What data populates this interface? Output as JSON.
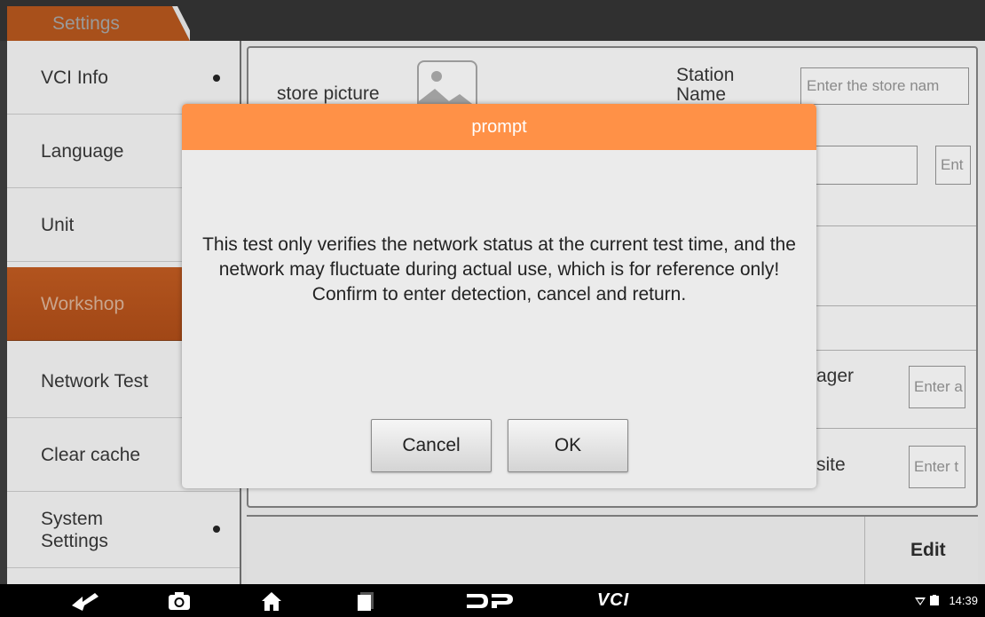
{
  "header": {
    "tab_label": "Settings"
  },
  "sidebar": {
    "items": [
      {
        "label": "VCI Info",
        "has_dot": true,
        "active": false
      },
      {
        "label": "Language",
        "has_dot": false,
        "active": false
      },
      {
        "label": "Unit",
        "has_dot": false,
        "active": false
      },
      {
        "label": "Workshop",
        "has_dot": false,
        "active": true
      },
      {
        "label": "Network Test",
        "has_dot": false,
        "active": false
      },
      {
        "label": "Clear cache",
        "has_dot": false,
        "active": false
      },
      {
        "label": "System Settings",
        "label_line1": "System",
        "label_line2": "Settings",
        "has_dot": true,
        "active": false
      }
    ]
  },
  "workshop": {
    "store_picture_label": "store picture",
    "station_name_label_line1": "Station",
    "station_name_label_line2": "Name",
    "store_name_placeholder": "Enter the store nam",
    "row2_input_placeholder": "Ent",
    "manager_label_fragment": "ager",
    "manager_input_placeholder": "Enter a",
    "website_label_fragment": "site",
    "website_input_placeholder": "Enter t",
    "edit_button_label": "Edit"
  },
  "dialog": {
    "title": "prompt",
    "message": "This test only verifies the network status at the current test time, and the network may fluctuate during actual use, which is for reference only! Confirm to enter detection, cancel and return.",
    "cancel_label": "Cancel",
    "ok_label": "OK"
  },
  "navbar": {
    "icons": [
      "back-icon",
      "camera-icon",
      "home-icon",
      "recents-icon",
      "dp-logo-icon",
      "vci-logo-icon"
    ],
    "dp_text": "DP",
    "vci_text": "VCI",
    "time": "14:39"
  },
  "colors": {
    "accent_orange": "#ff9147",
    "active_tab": "#a8501b",
    "background_dark": "#303030"
  }
}
